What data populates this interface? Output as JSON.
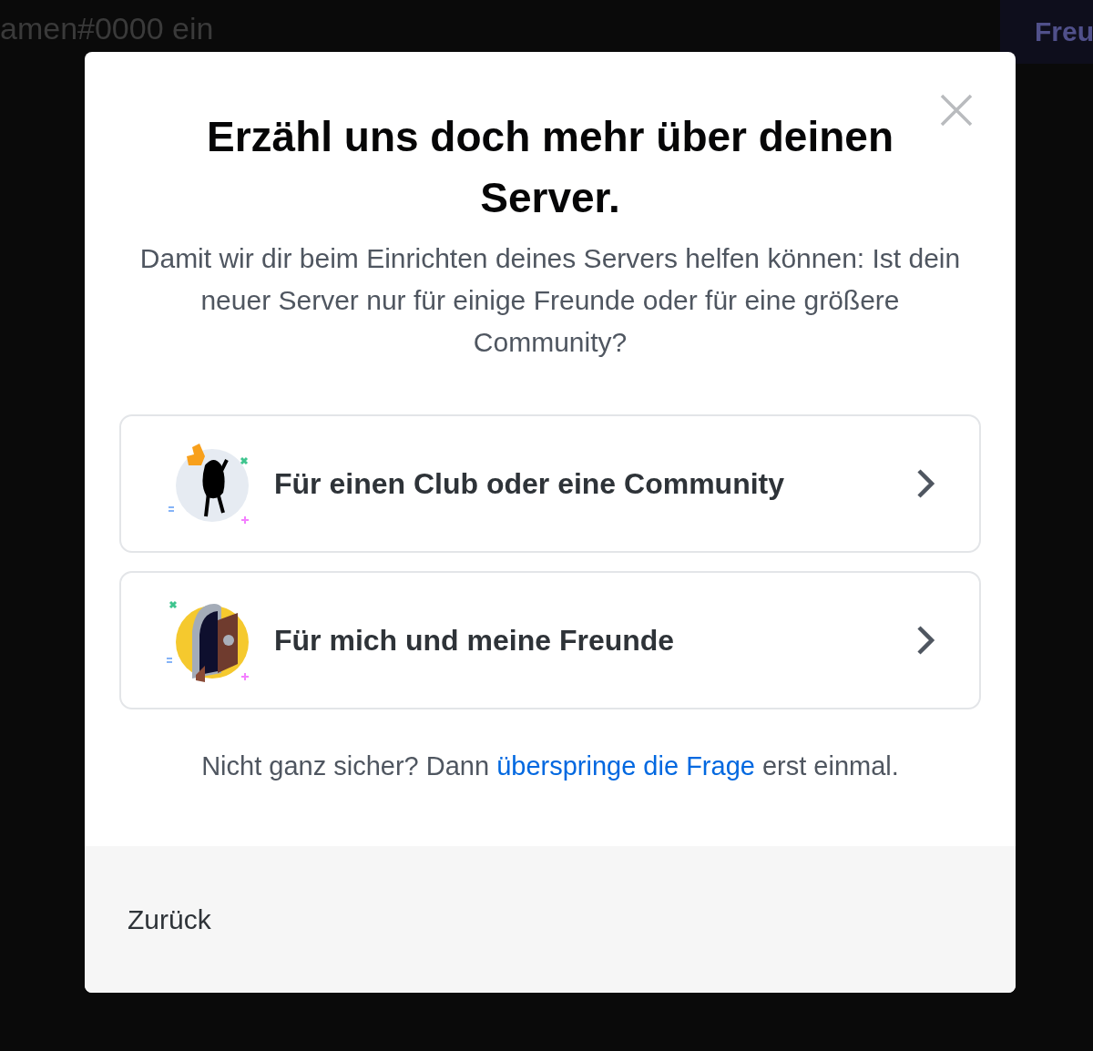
{
  "background": {
    "text": "amen#0000 ein",
    "button": "Freu"
  },
  "dialog": {
    "title": "Erzähl uns doch mehr über deinen Server.",
    "description": "Damit wir dir beim Einrichten deines Servers helfen können: Ist dein neuer Server nur für einige Freunde oder für eine größere Community?",
    "options": [
      {
        "kind": "club",
        "label": "Für einen Club oder eine Community"
      },
      {
        "kind": "friends",
        "label": "Für mich und meine Freunde"
      }
    ],
    "hint": {
      "before": "Nicht ganz sicher? Dann ",
      "link": "überspringe die Frage",
      "after": " erst einmal."
    },
    "back_button": "Zurück"
  }
}
